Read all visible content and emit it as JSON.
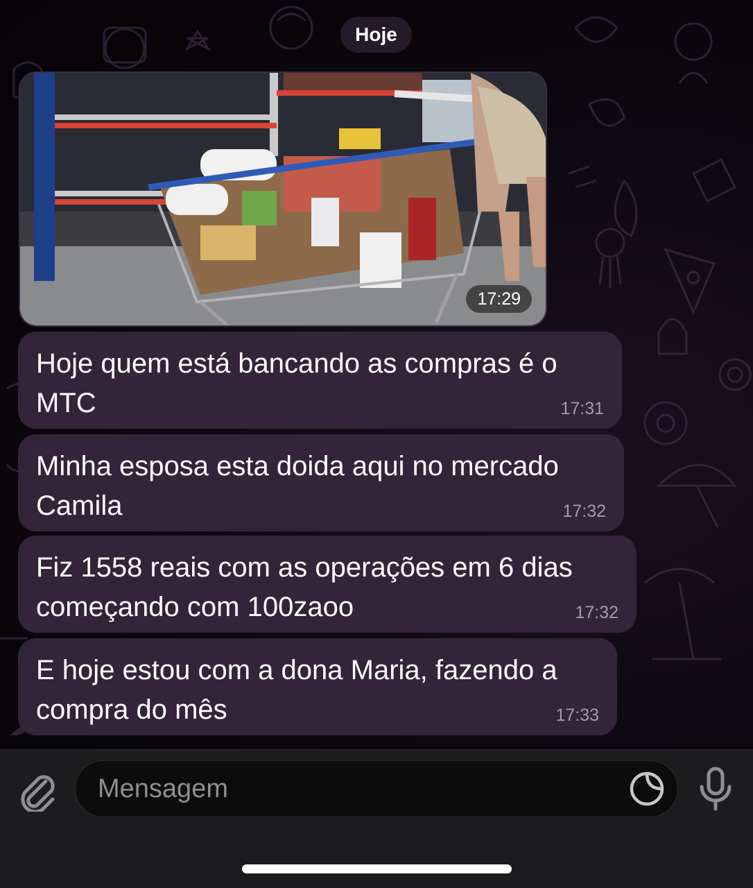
{
  "chat": {
    "date_divider": "Hoje",
    "photo_message": {
      "time": "17:29"
    },
    "messages": [
      {
        "text": "Hoje quem está bancando as compras é o MTC",
        "time": "17:31"
      },
      {
        "text": "Minha esposa esta doida aqui no mercado Camila",
        "time": "17:32"
      },
      {
        "text": "Fiz 1558 reais com as operações em 6 dias começando com 100zaoo",
        "time": "17:32"
      },
      {
        "text": "E hoje estou com a dona Maria, fazendo a compra do mês",
        "time": "17:33"
      }
    ]
  },
  "composer": {
    "placeholder": "Mensagem",
    "icons": [
      "paperclip-icon",
      "sticker-icon",
      "microphone-icon"
    ]
  },
  "colors": {
    "bubble": "#33243a",
    "composer_bg": "#1c1c1e",
    "timestamp": "#a898ad"
  }
}
